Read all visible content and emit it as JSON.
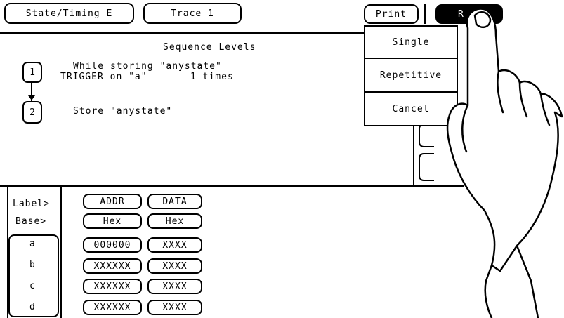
{
  "header": {
    "mode_button": "State/Timing E",
    "trace_button": "Trace 1",
    "print_button": "Print",
    "run_button": "R"
  },
  "sequence": {
    "title": "Sequence Levels",
    "levels": [
      {
        "number": "1",
        "line1": "While storing \"anystate\"",
        "line2": "TRIGGER on \"a\"",
        "times": "1 times"
      },
      {
        "number": "2",
        "line1": "Store \"anystate\""
      }
    ]
  },
  "run_menu": {
    "items": [
      "Single",
      "Repetitive",
      "Cancel"
    ]
  },
  "term_table": {
    "label_header": "Label>",
    "base_header": "Base>",
    "columns": [
      {
        "label": "ADDR",
        "base": "Hex"
      },
      {
        "label": "DATA",
        "base": "Hex"
      }
    ],
    "rows": [
      {
        "term": "a",
        "addr": "000000",
        "data": "XXXX"
      },
      {
        "term": "b",
        "addr": "XXXXXX",
        "data": "XXXX"
      },
      {
        "term": "c",
        "addr": "XXXXXX",
        "data": "XXXX"
      },
      {
        "term": "d",
        "addr": "XXXXXX",
        "data": "XXXX"
      }
    ]
  }
}
